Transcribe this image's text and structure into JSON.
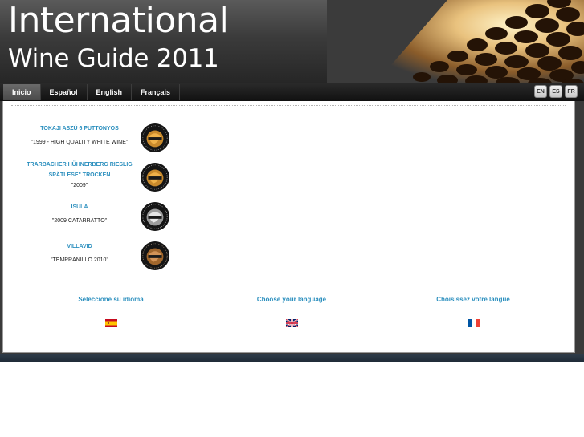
{
  "header": {
    "title_line1": "International",
    "title_line2": "Wine Guide 2011"
  },
  "nav": {
    "tabs": [
      {
        "label": "Inicio",
        "active": true
      },
      {
        "label": "Español"
      },
      {
        "label": "English"
      },
      {
        "label": "Français"
      }
    ],
    "lang_buttons": [
      "EN",
      "ES",
      "FR"
    ]
  },
  "wines": [
    {
      "name": "TOKAJI ASZÚ 6 PUTTONYOS",
      "desc": "\"1999 - HIGH QUALITY WHITE WINE\"",
      "medal": "gold-medal-icon"
    },
    {
      "name": "TRARBACHER HÜHNERBERG RIESLIG SPÄTLESE\" TROCKEN",
      "desc": "\"2009\"",
      "medal": "gold-medal-icon"
    },
    {
      "name": "ISULA",
      "desc": "\"2009 CATARRATTO\"",
      "medal": "silver-medal-icon"
    },
    {
      "name": "VILLAVID",
      "desc": "\"TEMPRANILLO 2010\"",
      "medal": "bronze-medal-icon"
    }
  ],
  "language_choices": [
    {
      "prompt": "Seleccione su idioma",
      "flag": "spain-flag-icon"
    },
    {
      "prompt": "Choose your language",
      "flag": "uk-flag-icon"
    },
    {
      "prompt": "Choisissez votre langue",
      "flag": "france-flag-icon"
    }
  ],
  "colors": {
    "accent": "#2b8fbe",
    "header_bg": "#3b3b3b",
    "nav_bg": "#111111",
    "footer_bg": "#1e2a36"
  }
}
